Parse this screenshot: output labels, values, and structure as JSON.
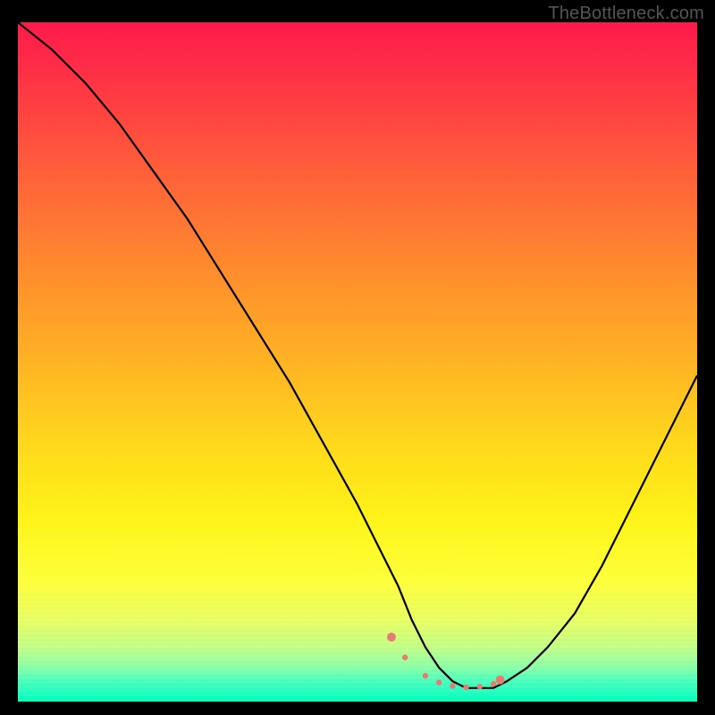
{
  "watermark": "TheBottleneck.com",
  "colors": {
    "background": "#000000",
    "gradient_top": "#ff1a4b",
    "gradient_mid": "#ffd81c",
    "gradient_bottom": "#00ffb8",
    "curve": "#000000",
    "markers": "#e77b74",
    "watermark": "#555555"
  },
  "chart_data": {
    "type": "line",
    "title": "",
    "xlabel": "",
    "ylabel": "",
    "xlim": [
      0,
      100
    ],
    "ylim": [
      0,
      100
    ],
    "grid": false,
    "series": [
      {
        "name": "bottleneck-curve",
        "x": [
          0,
          5,
          10,
          15,
          20,
          25,
          30,
          35,
          40,
          45,
          50,
          53,
          56,
          58,
          60,
          62,
          64,
          66,
          68,
          70,
          72,
          75,
          78,
          82,
          86,
          90,
          95,
          100
        ],
        "y": [
          100,
          96,
          91,
          85,
          78,
          71,
          63,
          55,
          47,
          38,
          29,
          23,
          17,
          12,
          8,
          5,
          3,
          2,
          2,
          2,
          3,
          5,
          8,
          13,
          20,
          28,
          38,
          48
        ]
      }
    ],
    "markers": {
      "name": "highlight-dots",
      "x": [
        55,
        57,
        60,
        62,
        64,
        66,
        68,
        70,
        71
      ],
      "y": [
        9.5,
        6.5,
        3.8,
        2.8,
        2.3,
        2.1,
        2.2,
        2.6,
        3.2
      ]
    },
    "annotations": []
  }
}
